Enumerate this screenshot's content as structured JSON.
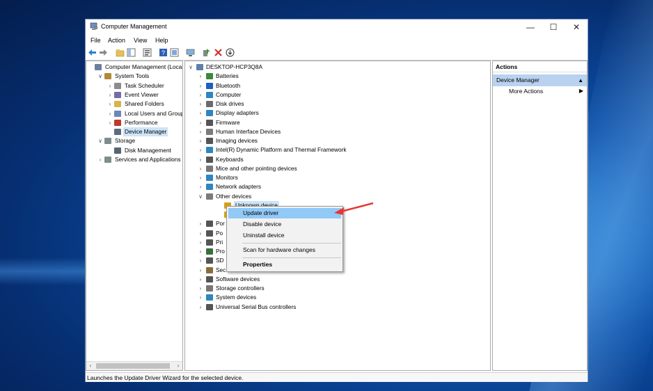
{
  "window": {
    "title": "Computer Management",
    "controls": {
      "minimize": "—",
      "maximize": "☐",
      "close": "✕"
    }
  },
  "menu": [
    "File",
    "Action",
    "View",
    "Help"
  ],
  "left_tree": [
    {
      "label": "Computer Management (Local",
      "indent": 0,
      "arrow": "",
      "icon": "computer-management-icon",
      "color": "#6b7fa0"
    },
    {
      "label": "System Tools",
      "indent": 1,
      "arrow": "∨",
      "icon": "tools-icon",
      "color": "#b08a3a"
    },
    {
      "label": "Task Scheduler",
      "indent": 2,
      "arrow": "›",
      "icon": "clock-icon",
      "color": "#8c8c8c"
    },
    {
      "label": "Event Viewer",
      "indent": 2,
      "arrow": "›",
      "icon": "event-viewer-icon",
      "color": "#7a6aa8"
    },
    {
      "label": "Shared Folders",
      "indent": 2,
      "arrow": "›",
      "icon": "shared-folder-icon",
      "color": "#d9b44a"
    },
    {
      "label": "Local Users and Groups",
      "indent": 2,
      "arrow": "›",
      "icon": "users-icon",
      "color": "#6a88b8"
    },
    {
      "label": "Performance",
      "indent": 2,
      "arrow": "›",
      "icon": "performance-icon",
      "color": "#c0392b"
    },
    {
      "label": "Device Manager",
      "indent": 2,
      "arrow": "",
      "icon": "device-manager-icon",
      "color": "#5d6d7e",
      "selected": true
    },
    {
      "label": "Storage",
      "indent": 1,
      "arrow": "∨",
      "icon": "storage-icon",
      "color": "#7f8c8d"
    },
    {
      "label": "Disk Management",
      "indent": 2,
      "arrow": "",
      "icon": "disk-management-icon",
      "color": "#566573"
    },
    {
      "label": "Services and Applications",
      "indent": 1,
      "arrow": "›",
      "icon": "services-icon",
      "color": "#7f8c8d"
    }
  ],
  "device_tree": {
    "root": "DESKTOP-HCP3Q8A",
    "items": [
      {
        "label": "Batteries",
        "icon": "battery-icon",
        "color": "#3b8a3b"
      },
      {
        "label": "Bluetooth",
        "icon": "bluetooth-icon",
        "color": "#1f5fbf"
      },
      {
        "label": "Computer",
        "icon": "computer-icon",
        "color": "#2e86c1"
      },
      {
        "label": "Disk drives",
        "icon": "disk-drive-icon",
        "color": "#6b6b6b"
      },
      {
        "label": "Display adapters",
        "icon": "display-adapter-icon",
        "color": "#2e86c1"
      },
      {
        "label": "Firmware",
        "icon": "firmware-icon",
        "color": "#555555"
      },
      {
        "label": "Human Interface Devices",
        "icon": "hid-icon",
        "color": "#7b7b7b"
      },
      {
        "label": "Imaging devices",
        "icon": "camera-icon",
        "color": "#555555"
      },
      {
        "label": "Intel(R) Dynamic Platform and Thermal Framework",
        "icon": "thermal-icon",
        "color": "#2e86c1"
      },
      {
        "label": "Keyboards",
        "icon": "keyboard-icon",
        "color": "#555555"
      },
      {
        "label": "Mice and other pointing devices",
        "icon": "mouse-icon",
        "color": "#777777"
      },
      {
        "label": "Monitors",
        "icon": "monitor-icon",
        "color": "#2e86c1"
      },
      {
        "label": "Network adapters",
        "icon": "network-adapter-icon",
        "color": "#2e86c1"
      },
      {
        "label": "Other devices",
        "icon": "other-devices-icon",
        "color": "#7b7b7b",
        "expanded": true
      },
      {
        "label": "Unknown device",
        "icon": "warning-device-icon",
        "color": "#d4a017",
        "child": true
      },
      {
        "label": "",
        "icon": "warning-device-icon",
        "color": "#d4a017",
        "child": true
      },
      {
        "label": "Por",
        "icon": "port-icon",
        "color": "#555555"
      },
      {
        "label": "Po",
        "icon": "print-queue-icon",
        "color": "#555555"
      },
      {
        "label": "Pri",
        "icon": "printer-icon",
        "color": "#555555"
      },
      {
        "label": "Pro",
        "icon": "processor-icon",
        "color": "#3b6e3b"
      },
      {
        "label": "SD",
        "icon": "sd-host-icon",
        "color": "#555555"
      },
      {
        "label": "Sec",
        "icon": "security-device-icon",
        "color": "#8a6d3b"
      },
      {
        "label": "Software devices",
        "icon": "software-device-icon",
        "color": "#555555"
      },
      {
        "label": "Storage controllers",
        "icon": "storage-controller-icon",
        "color": "#777777"
      },
      {
        "label": "System devices",
        "icon": "system-devices-icon",
        "color": "#2e86c1"
      },
      {
        "label": "Universal Serial Bus controllers",
        "icon": "usb-icon",
        "color": "#555555"
      }
    ]
  },
  "context_menu": {
    "items": [
      "Update driver",
      "Disable device",
      "Uninstall device",
      "Scan for hardware changes",
      "Properties"
    ]
  },
  "actions": {
    "title": "Actions",
    "section": "Device Manager",
    "section_caret": "▲",
    "more": "More Actions",
    "more_arrow": "▶"
  },
  "status": "Launches the Update Driver Wizard for the selected device.",
  "colors": {
    "selection": "#cce4f7",
    "menu_highlight": "#91c9f7",
    "actions_section": "#b8d2ef",
    "arrow": "#e53935"
  }
}
